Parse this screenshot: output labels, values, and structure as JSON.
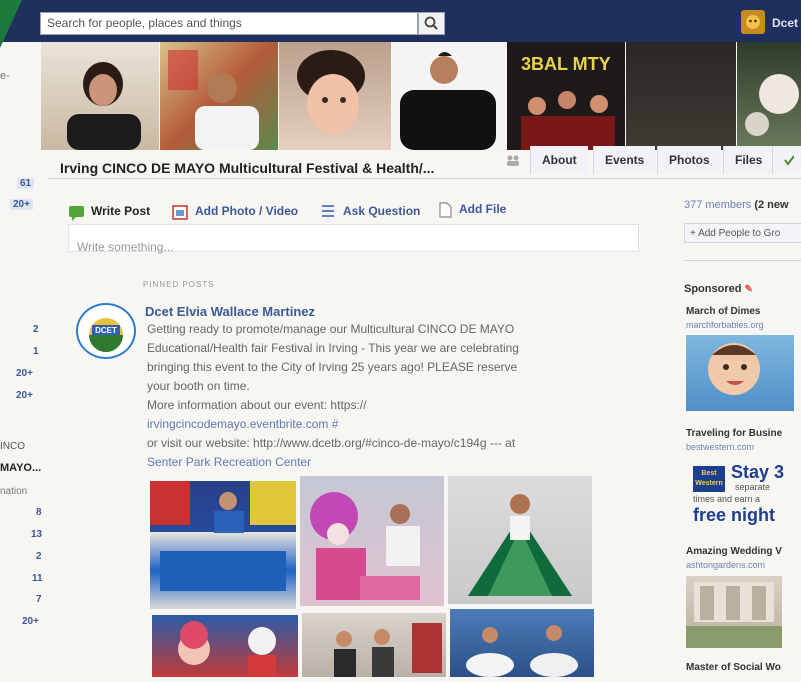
{
  "topbar": {
    "search_placeholder": "Search for people, places and things",
    "user_name": "Dcet"
  },
  "left_column": {
    "counts": [
      "61",
      "20+",
      "2",
      "1",
      "20+",
      "20+",
      "8",
      "13",
      "2",
      "11",
      "7",
      "20+"
    ],
    "labels": [
      "e-",
      "INCO",
      "MAYO...",
      "nation"
    ]
  },
  "group": {
    "title": "Irving CINCO DE MAYO Multicultural Festival & Health/...",
    "tabs": [
      "About",
      "Events",
      "Photos",
      "Files"
    ]
  },
  "composer": {
    "write_post": "Write Post",
    "add_photo": "Add Photo / Video",
    "ask_question": "Ask Question",
    "add_file": "Add File",
    "placeholder": "Write something..."
  },
  "post": {
    "pinned_label": "PINNED POSTS",
    "author": "Dcet Elvia Wallace Martinez",
    "logo_text": "DCET",
    "lines": [
      "Getting ready to promote/manage our Multicultural CINCO DE MAYO",
      "Educational/Health fair Festival in Irving - This year we are celebrating",
      "bringing this event to the City of Irving 25 years ago! PLEASE reserve",
      "your booth on time.",
      "More information about our event: https://",
      "irvingcincodemayo.eventbrite.com #",
      "or visit our website: http://www.dcetb.org/#cinco-de-mayo/c194g --- at",
      "Senter Park Recreation Center"
    ]
  },
  "right_column": {
    "members": "377 members",
    "members_new": "(2 new",
    "add_people": "+ Add People to Gro",
    "sponsored": "Sponsored",
    "ads": [
      {
        "title": "March of Dimes",
        "url": "marchforbabies.org"
      },
      {
        "title": "Traveling for Busine",
        "url": "bestwestern.com"
      },
      {
        "title": "Amazing Wedding V",
        "url": "ashtongardens.com"
      },
      {
        "title": "Master of Social Wo",
        "url": ""
      }
    ],
    "bw_ad": {
      "logo": "Best Western",
      "headline": "Stay 3",
      "line2": "separate",
      "line3": "times and earn a",
      "line4": "free night"
    }
  }
}
